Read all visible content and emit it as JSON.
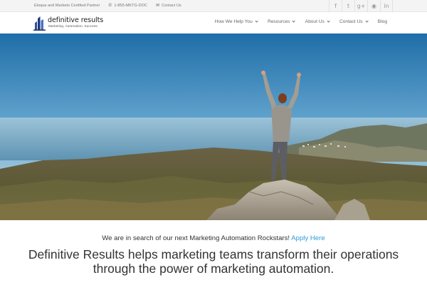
{
  "topbar": {
    "partner_text": "Eloqua and Marketo Certified Partner",
    "phone_icon": "phone-icon",
    "phone": "1-855-MKTG-DOC",
    "mail_icon": "envelope-icon",
    "contact": "Contact Us",
    "social": [
      {
        "icon": "facebook-icon",
        "glyph": "f"
      },
      {
        "icon": "twitter-icon",
        "glyph": "t"
      },
      {
        "icon": "google-plus-icon",
        "glyph": "g+"
      },
      {
        "icon": "rss-icon",
        "glyph": "◉"
      },
      {
        "icon": "linkedin-icon",
        "glyph": "in"
      }
    ]
  },
  "brand": {
    "name": "definitive results",
    "tagline": "Marketing. Automation. Success."
  },
  "nav": {
    "items": [
      {
        "label": "How We Help You",
        "dropdown": true
      },
      {
        "label": "Resources",
        "dropdown": true
      },
      {
        "label": "About Us",
        "dropdown": true
      },
      {
        "label": "Contact Us",
        "dropdown": true
      },
      {
        "label": "Blog",
        "dropdown": false
      }
    ]
  },
  "main": {
    "recruit_text": "We are in search of our next Marketing Automation Rockstars!",
    "apply_link": "Apply Here",
    "mission_line1": "Definitive Results helps marketing teams transform their operations",
    "mission_line2": "through the power of marketing automation."
  },
  "colors": {
    "link": "#2e9ad8",
    "logo_blue": "#2d4f9c"
  }
}
